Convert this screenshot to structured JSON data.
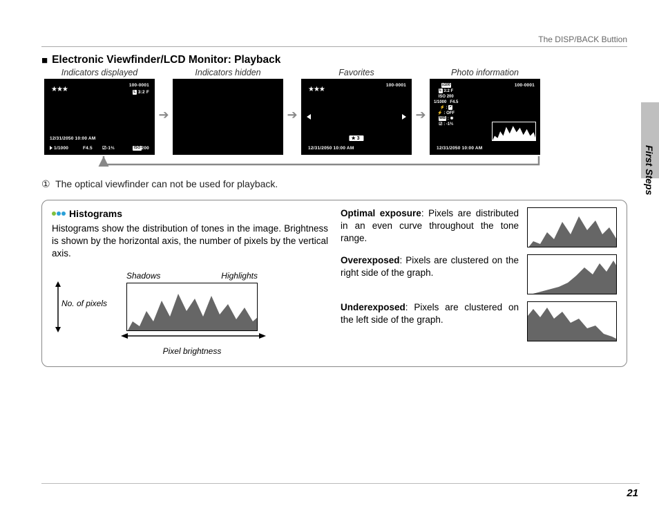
{
  "header": {
    "running": "The DISP/BACK Buttion"
  },
  "section": {
    "title": "Electronic Viewfinder/LCD Monitor: Playback"
  },
  "modes": {
    "labels": [
      "Indicators displayed",
      "Indicators hidden",
      "Favorites",
      "Photo information"
    ],
    "frame_no": "100-0001",
    "size_ratio": "3:2 F",
    "size_prefix": "L",
    "stars": "★★★",
    "datetime": "12/31/2050   10:00  AM",
    "bar_shutter": "1/1000",
    "bar_aperture": "F4.5",
    "bar_ev": "-1⅔",
    "bar_iso_suffix": "200",
    "fav_badge": "★  3",
    "info": {
      "size": "L 3:2 F",
      "iso": "ISO 200",
      "shutter": "1/1000",
      "aperture": "F4.5",
      "flash_label": "⚡ :",
      "flash_val": "OFF",
      "wb_label": "WB :",
      "wb_val": "✹",
      "ev_label": "☑ :",
      "ev_val": "-1⅔"
    }
  },
  "note": "The optical viewfinder can not be used for playback.",
  "histograms": {
    "title": "Histograms",
    "intro": "Histograms show the distribution of tones in the image.  Brightness is shown by the horizontal axis, the number of pixels by the vertical axis.",
    "y_label": "No. of pixels",
    "x_label": "Pixel brightness",
    "shadows": "Shadows",
    "highlights": "Highlights",
    "optimal_b": "Optimal exposure",
    "optimal": ": Pixels are distributed in an even curve throughout the tone range.",
    "over_b": "Overexposed",
    "over": ": Pixels are clustered on the right side of the graph.",
    "under_b": "Underexposed",
    "under": ": Pixels are clustered on the left side of the graph."
  },
  "side": {
    "label": "First Steps"
  },
  "page_number": "21"
}
